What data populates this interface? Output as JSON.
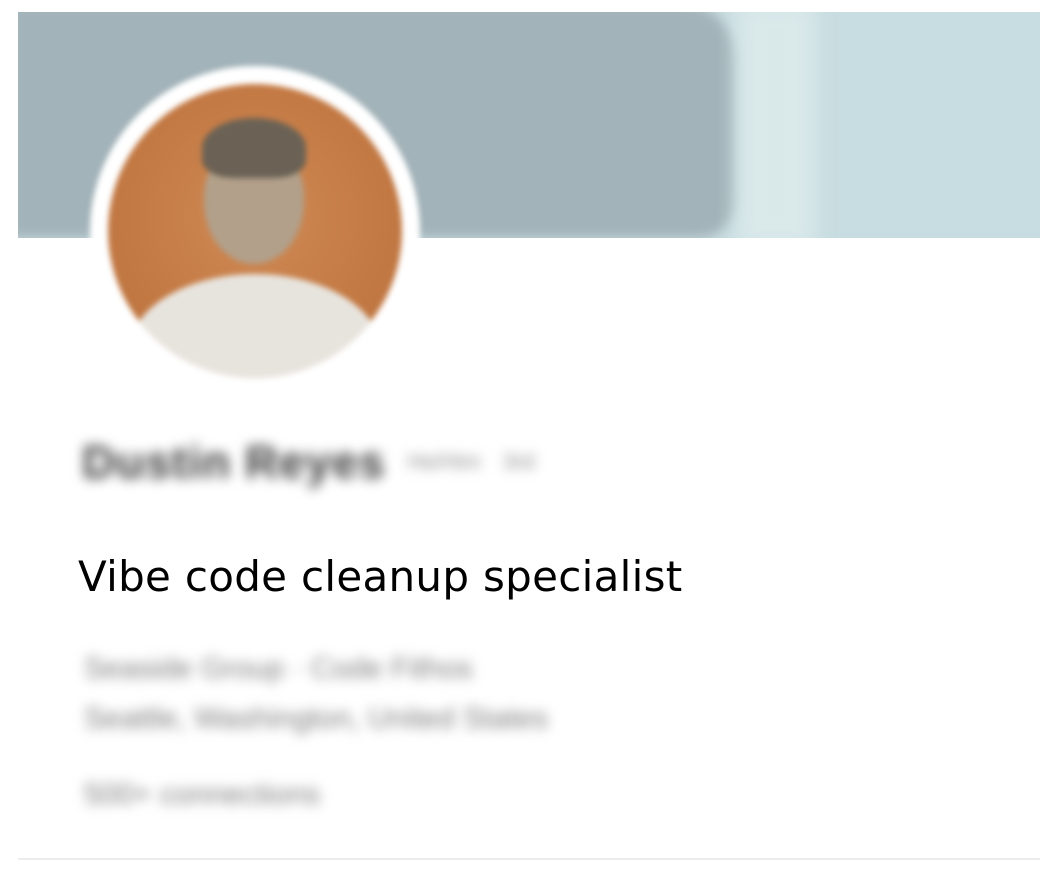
{
  "profile": {
    "name": "Dustin Reyes",
    "pronouns": "He/Him",
    "degree": "3rd",
    "headline": "Vibe code cleanup specialist",
    "company_line": "Seaside Group · Code Fithos",
    "location": "Seattle, Washington, United States",
    "connections": "500+ connections"
  },
  "colors": {
    "banner_dark": "#a2b3b9",
    "banner_light": "#c8dde1",
    "avatar_background": "#c47a44"
  }
}
